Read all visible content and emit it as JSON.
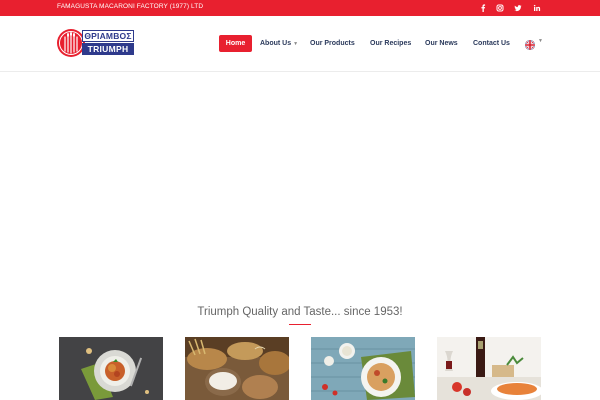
{
  "topbar": {
    "company": "FAMAGUSTA MACARONI FACTORY (1977) LTD",
    "social_icons": [
      "facebook-icon",
      "instagram-icon",
      "twitter-icon",
      "linkedin-icon"
    ]
  },
  "logo": {
    "greek": "ΘΡΙΑΜΒΟΣ",
    "english": "TRIUMPH"
  },
  "nav": {
    "items": [
      {
        "label": "Home",
        "active": true
      },
      {
        "label": "About Us",
        "dropdown": true
      },
      {
        "label": "Our Products"
      },
      {
        "label": "Our Recipes"
      },
      {
        "label": "Our News"
      },
      {
        "label": "Contact Us"
      }
    ],
    "language_icon": "uk-flag-icon"
  },
  "main": {
    "tagline": "Triumph Quality and Taste... since 1953!",
    "photos": [
      "spaghetti-plate-photo",
      "bread-flour-photo",
      "pasta-bowl-photo",
      "pasta-dish-wine-photo"
    ]
  },
  "colors": {
    "accent": "#e8202f",
    "brand_blue": "#2e3a8c",
    "nav_text": "#2b3a5c"
  }
}
